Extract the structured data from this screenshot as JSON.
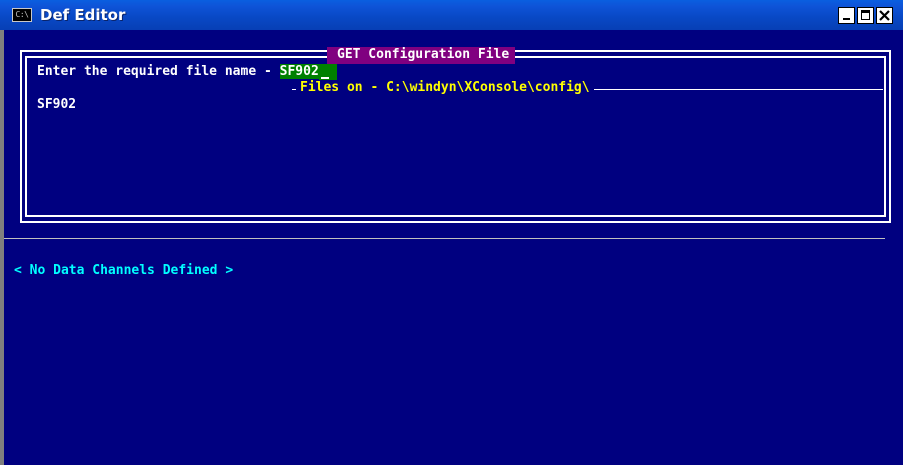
{
  "window": {
    "title": "Def Editor",
    "icon_text": "C:\\",
    "icon": "console-icon",
    "controls": {
      "minimize": "minimize-icon",
      "maximize": "maximize-icon",
      "close": "close-icon"
    }
  },
  "dialog": {
    "title": "GET Configuration File",
    "prompt_label": "Enter the required file name - ",
    "prompt_value": "SF902",
    "files_header": "Files on - C:\\windyn\\XConsole\\config\\",
    "files": [
      "SF902"
    ]
  },
  "status": {
    "message": "< No Data Channels Defined >"
  },
  "colors": {
    "background": "#000080",
    "dialog_title_bg": "#800080",
    "input_bg": "#008000",
    "files_header": "#ffff00",
    "status_text": "#00ffff"
  }
}
